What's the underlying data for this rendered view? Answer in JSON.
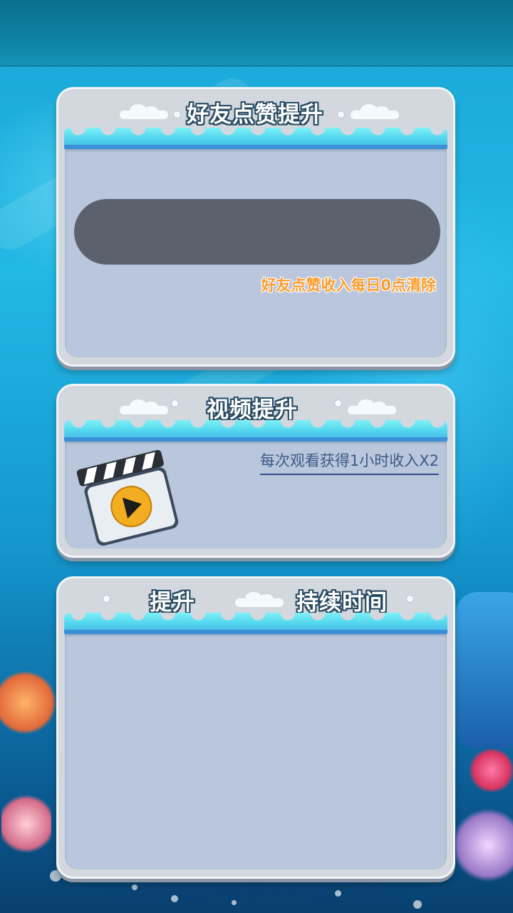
{
  "panels": {
    "friend_like": {
      "title": "好友点赞提升",
      "note": "好友点赞收入每日0点清除"
    },
    "video": {
      "title": "视频提升",
      "description": "每次观看获得1小时收入X2",
      "icon": "video-clapperboard-icon"
    },
    "boost_list": {
      "header_boost": "提升",
      "header_duration": "持续时间"
    }
  },
  "colors": {
    "title_outline": "#274a63",
    "note_orange": "#ff9c2a",
    "panel_inner": "#b9c6dc",
    "progress_track": "#5b626d"
  }
}
